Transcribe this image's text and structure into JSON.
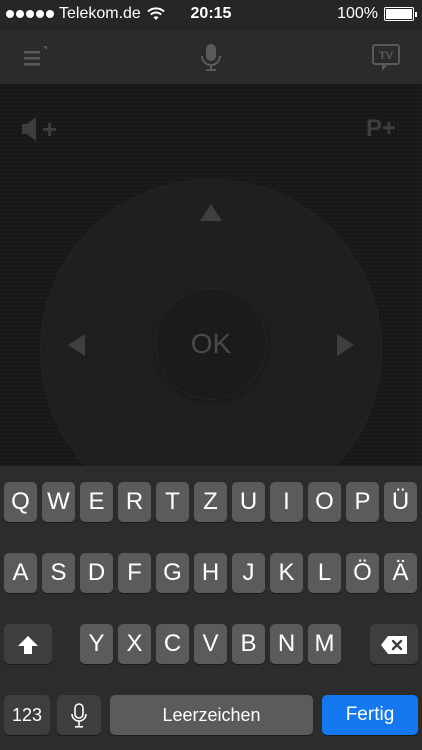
{
  "status_bar": {
    "carrier": "Telekom.de",
    "time": "20:15",
    "battery": "100%",
    "icons": [
      "signal-dots-icon",
      "wifi-icon",
      "battery-icon"
    ]
  },
  "toolbar": {
    "icons": [
      "menu-icon",
      "microphone-icon",
      "tv-icon"
    ],
    "tv_label": "TV"
  },
  "remote": {
    "volume_label": "+",
    "program_label": "P+",
    "ok_label": "OK",
    "icons": [
      "volume-up-icon",
      "arrow-up-icon",
      "arrow-left-icon",
      "arrow-right-icon"
    ]
  },
  "keyboard": {
    "row1": [
      "Q",
      "W",
      "E",
      "R",
      "T",
      "Z",
      "U",
      "I",
      "O",
      "P",
      "Ü"
    ],
    "row2": [
      "A",
      "S",
      "D",
      "F",
      "G",
      "H",
      "J",
      "K",
      "L",
      "Ö",
      "Ä"
    ],
    "row3": [
      "Y",
      "X",
      "C",
      "V",
      "B",
      "N",
      "M"
    ],
    "numbers_label": "123",
    "space_label": "Leerzeichen",
    "done_label": "Fertig",
    "accent_color": "#1478f0",
    "icons": [
      "shift-icon",
      "backspace-icon",
      "dictation-mic-icon"
    ]
  }
}
